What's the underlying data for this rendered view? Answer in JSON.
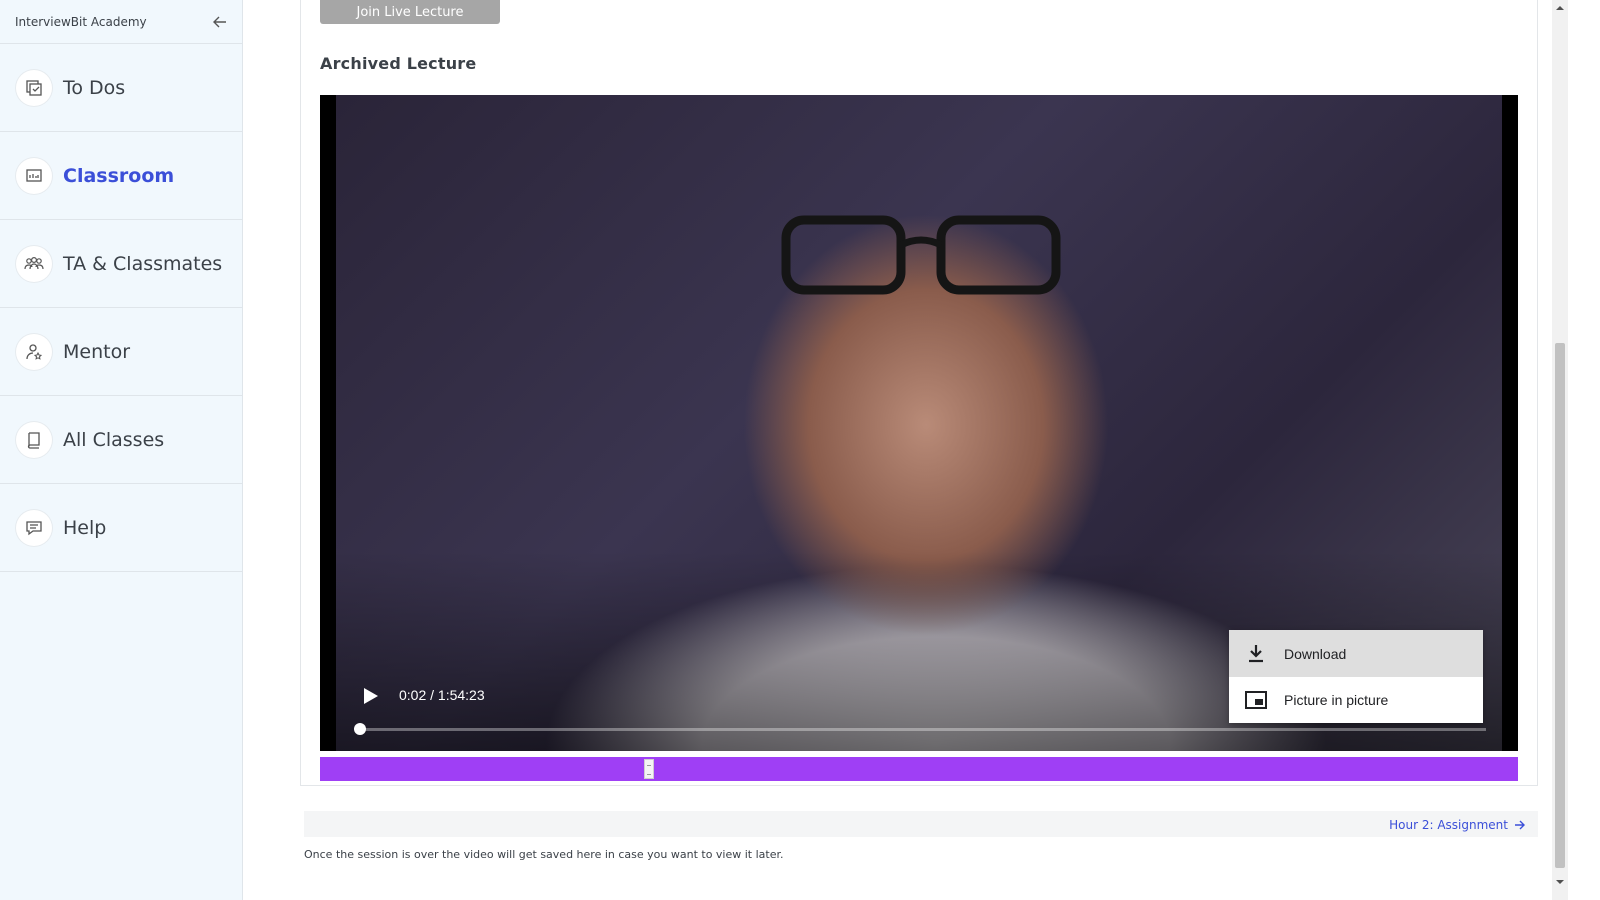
{
  "sidebar": {
    "brand": "InterviewBit Academy",
    "collapse_icon": "arrow-left-icon",
    "items": [
      {
        "label": "To Dos",
        "icon": "todo-icon",
        "active": false
      },
      {
        "label": "Classroom",
        "icon": "classroom-icon",
        "active": true
      },
      {
        "label": "TA & Classmates",
        "icon": "people-icon",
        "active": false
      },
      {
        "label": "Mentor",
        "icon": "mentor-icon",
        "active": false
      },
      {
        "label": "All Classes",
        "icon": "book-icon",
        "active": false
      },
      {
        "label": "Help",
        "icon": "help-chat-icon",
        "active": false
      }
    ]
  },
  "main": {
    "join_button_label": "Join Live Lecture",
    "archived_title": "Archived Lecture",
    "video": {
      "time_display": "0:02 / 1:54:23",
      "progress_fraction": 0.0003,
      "menu": [
        {
          "label": "Download",
          "icon": "download-icon"
        },
        {
          "label": "Picture in picture",
          "icon": "picture-in-picture-icon"
        }
      ]
    },
    "next_link_label": "Hour 2: Assignment",
    "footer_note": "Once the session is over the video will get saved here in case you want to view it later."
  },
  "colors": {
    "accent": "#3b4fd8",
    "purple_bar": "#9f3ff5",
    "sidebar_bg": "#f1f8fd"
  }
}
